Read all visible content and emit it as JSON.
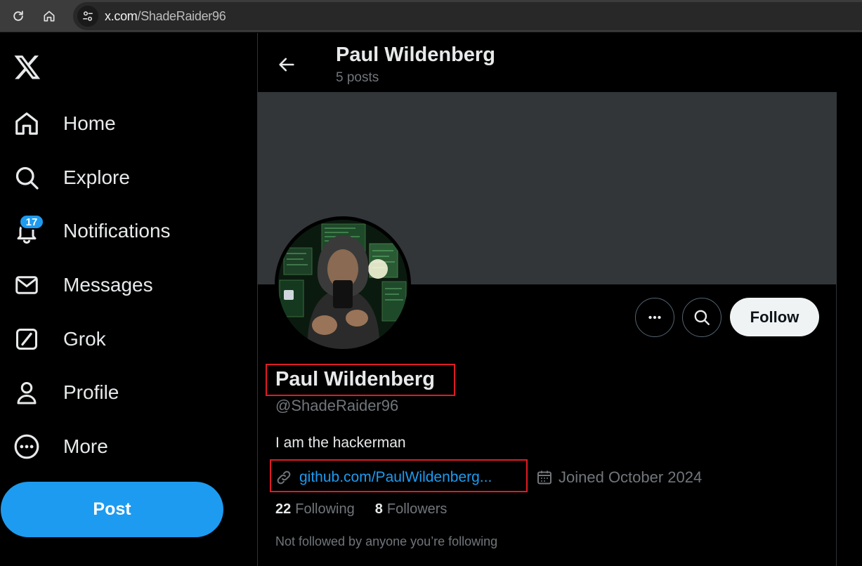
{
  "browser": {
    "url_host": "x.com",
    "url_path": "/ShadeRaider96"
  },
  "nav": {
    "items": [
      {
        "label": "Home",
        "icon": "home-icon"
      },
      {
        "label": "Explore",
        "icon": "search-icon"
      },
      {
        "label": "Notifications",
        "icon": "bell-icon",
        "badge": "17"
      },
      {
        "label": "Messages",
        "icon": "envelope-icon"
      },
      {
        "label": "Grok",
        "icon": "grok-icon"
      },
      {
        "label": "Profile",
        "icon": "person-icon"
      },
      {
        "label": "More",
        "icon": "more-circle-icon"
      }
    ],
    "post_label": "Post"
  },
  "header": {
    "title": "Paul Wildenberg",
    "posts_count": "5 posts"
  },
  "profile": {
    "name": "Paul Wildenberg",
    "handle": "@ShadeRaider96",
    "bio": "I am the hackerman",
    "link": "github.com/PaulWildenberg...",
    "joined": "Joined October 2024",
    "following_count": "22",
    "following_label": "Following",
    "followers_count": "8",
    "followers_label": "Followers",
    "not_followed": "Not followed by anyone you’re following",
    "follow_label": "Follow"
  },
  "colors": {
    "accent": "#1d9bf0",
    "highlight_box": "#e11b22",
    "banner": "#333639"
  }
}
